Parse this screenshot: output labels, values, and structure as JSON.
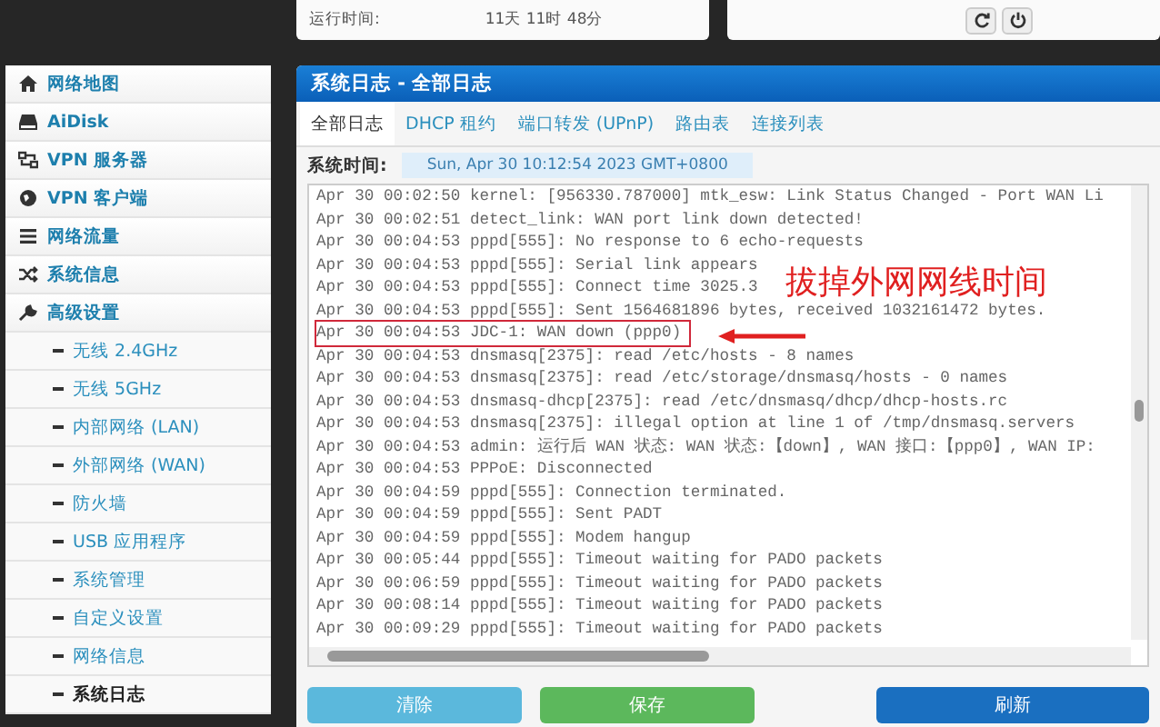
{
  "status": {
    "label": "运行时间:",
    "value": "11天 11时 48分"
  },
  "top_actions": [
    {
      "kind": "refresh"
    },
    {
      "kind": "power"
    }
  ],
  "sidebar": {
    "items": [
      {
        "label": "网络地图",
        "selected": false
      },
      {
        "label": "AiDisk",
        "selected": false
      },
      {
        "label": "VPN 服务器",
        "selected": false
      },
      {
        "label": "VPN 客户端",
        "selected": false
      },
      {
        "label": "网络流量",
        "selected": false
      },
      {
        "label": "系统信息",
        "selected": false
      },
      {
        "label": "高级设置",
        "selected": false,
        "children": [
          {
            "label": "无线 2.4GHz",
            "selected": false
          },
          {
            "label": "无线 5GHz",
            "selected": false
          },
          {
            "label": "内部网络 (LAN)",
            "selected": false
          },
          {
            "label": "外部网络 (WAN)",
            "selected": false
          },
          {
            "label": "防火墙",
            "selected": false
          },
          {
            "label": "USB 应用程序",
            "selected": false
          },
          {
            "label": "系统管理",
            "selected": false
          },
          {
            "label": "自定义设置",
            "selected": false
          },
          {
            "label": "网络信息",
            "selected": false
          },
          {
            "label": "系统日志",
            "selected": true
          }
        ]
      }
    ]
  },
  "panel": {
    "title": "系统日志 - 全部日志",
    "tabs": [
      {
        "label": "全部日志",
        "selected": true
      },
      {
        "label": "DHCP 租约",
        "selected": false
      },
      {
        "label": "端口转发 (UPnP)",
        "selected": false
      },
      {
        "label": "路由表",
        "selected": false
      },
      {
        "label": "连接列表",
        "selected": false
      }
    ],
    "system_time": {
      "label": "系统时间:",
      "value": "Sun, Apr 30 10:12:54 2023 GMT+0800"
    },
    "log_lines": [
      {
        "text": "Apr 30 00:02:50 kernel: [956330.787000] mtk_esw: Link Status Changed - Port WAN Li",
        "highlighted": false
      },
      {
        "text": "Apr 30 00:02:51 detect_link: WAN port link down detected!",
        "highlighted": false
      },
      {
        "text": "Apr 30 00:04:53 pppd[555]: No response to 6 echo-requests",
        "highlighted": false
      },
      {
        "text": "Apr 30 00:04:53 pppd[555]: Serial link appears",
        "highlighted": false
      },
      {
        "text": "Apr 30 00:04:53 pppd[555]: Connect time 3025.3",
        "highlighted": false
      },
      {
        "text": "Apr 30 00:04:53 pppd[555]: Sent 1564681896 bytes, received 1032161472 bytes.",
        "highlighted": false
      },
      {
        "text": "Apr 30 00:04:53 JDC-1: WAN down (ppp0)",
        "highlighted": true
      },
      {
        "text": "Apr 30 00:04:53 dnsmasq[2375]: read /etc/hosts - 8 names",
        "highlighted": false
      },
      {
        "text": "Apr 30 00:04:53 dnsmasq[2375]: read /etc/storage/dnsmasq/hosts - 0 names",
        "highlighted": false
      },
      {
        "text": "Apr 30 00:04:53 dnsmasq-dhcp[2375]: read /etc/dnsmasq/dhcp/dhcp-hosts.rc",
        "highlighted": false
      },
      {
        "text": "Apr 30 00:04:53 dnsmasq[2375]: illegal option at line 1 of /tmp/dnsmasq.servers",
        "highlighted": false
      },
      {
        "text": "Apr 30 00:04:53 admin: 运行后 WAN 状态: WAN 状态:【down】, WAN 接口:【ppp0】, WAN IP:",
        "highlighted": false
      },
      {
        "text": "Apr 30 00:04:53 PPPoE: Disconnected",
        "highlighted": false
      },
      {
        "text": "Apr 30 00:04:59 pppd[555]: Connection terminated.",
        "highlighted": false
      },
      {
        "text": "Apr 30 00:04:59 pppd[555]: Sent PADT",
        "highlighted": false
      },
      {
        "text": "Apr 30 00:04:59 pppd[555]: Modem hangup",
        "highlighted": false
      },
      {
        "text": "Apr 30 00:05:44 pppd[555]: Timeout waiting for PADO packets",
        "highlighted": false
      },
      {
        "text": "Apr 30 00:06:59 pppd[555]: Timeout waiting for PADO packets",
        "highlighted": false
      },
      {
        "text": "Apr 30 00:08:14 pppd[555]: Timeout waiting for PADO packets",
        "highlighted": false
      },
      {
        "text": "Apr 30 00:09:29 pppd[555]: Timeout waiting for PADO packets",
        "highlighted": false
      }
    ],
    "annotation": "拔掉外网网线时间",
    "buttons": [
      {
        "label": "清除",
        "kind": "info"
      },
      {
        "label": "保存",
        "kind": "success"
      },
      {
        "label": "刷新",
        "kind": "primary"
      }
    ]
  }
}
